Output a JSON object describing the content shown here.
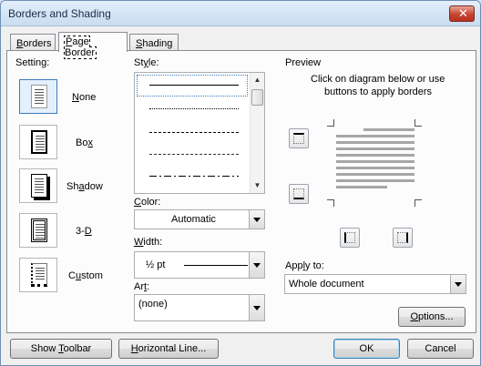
{
  "window": {
    "title": "Borders and Shading"
  },
  "tabs": [
    {
      "label": "Borders",
      "mnemonic": "B",
      "rest": "orders"
    },
    {
      "label": "Page Border",
      "pre": "",
      "mnemonic": "P",
      "rest": "age Border"
    },
    {
      "label": "Shading",
      "mnemonic": "S",
      "rest": "hading"
    }
  ],
  "setting": {
    "label": "Setting:",
    "options": [
      {
        "pre": "",
        "mn": "N",
        "post": "one",
        "label": "None"
      },
      {
        "pre": "Bo",
        "mn": "x",
        "post": "",
        "label": "Box"
      },
      {
        "pre": "Sh",
        "mn": "a",
        "post": "dow",
        "label": "Shadow"
      },
      {
        "pre": "3-",
        "mn": "D",
        "post": "",
        "label": "3-D"
      },
      {
        "pre": "C",
        "mn": "u",
        "post": "stom",
        "label": "Custom"
      }
    ]
  },
  "style": {
    "label": "Style:",
    "mn": "y",
    "pre": "St",
    "post": "le:"
  },
  "color": {
    "label": "Color:",
    "pre": "",
    "mn": "C",
    "post": "olor:",
    "value": "Automatic"
  },
  "width": {
    "label": "Width:",
    "pre": "",
    "mn": "W",
    "post": "idth:",
    "value": "½ pt"
  },
  "art": {
    "label": "Art:",
    "pre": "Ar",
    "mn": "t",
    "post": ":",
    "value": "(none)"
  },
  "preview": {
    "label": "Preview",
    "instructions_line1": "Click on diagram below or use",
    "instructions_line2": "buttons to apply borders"
  },
  "apply_to": {
    "pre": "App",
    "mn": "l",
    "post": "y to:",
    "label": "Apply to:",
    "value": "Whole document"
  },
  "buttons": {
    "options": {
      "pre": "",
      "mn": "O",
      "post": "ptions...",
      "label": "Options..."
    },
    "show_toolbar": {
      "pre": "Show ",
      "mn": "T",
      "post": "oolbar",
      "label": "Show Toolbar"
    },
    "horizontal_line": {
      "pre": "",
      "mn": "H",
      "post": "orizontal Line...",
      "label": "Horizontal Line..."
    },
    "ok": "OK",
    "cancel": "Cancel"
  }
}
